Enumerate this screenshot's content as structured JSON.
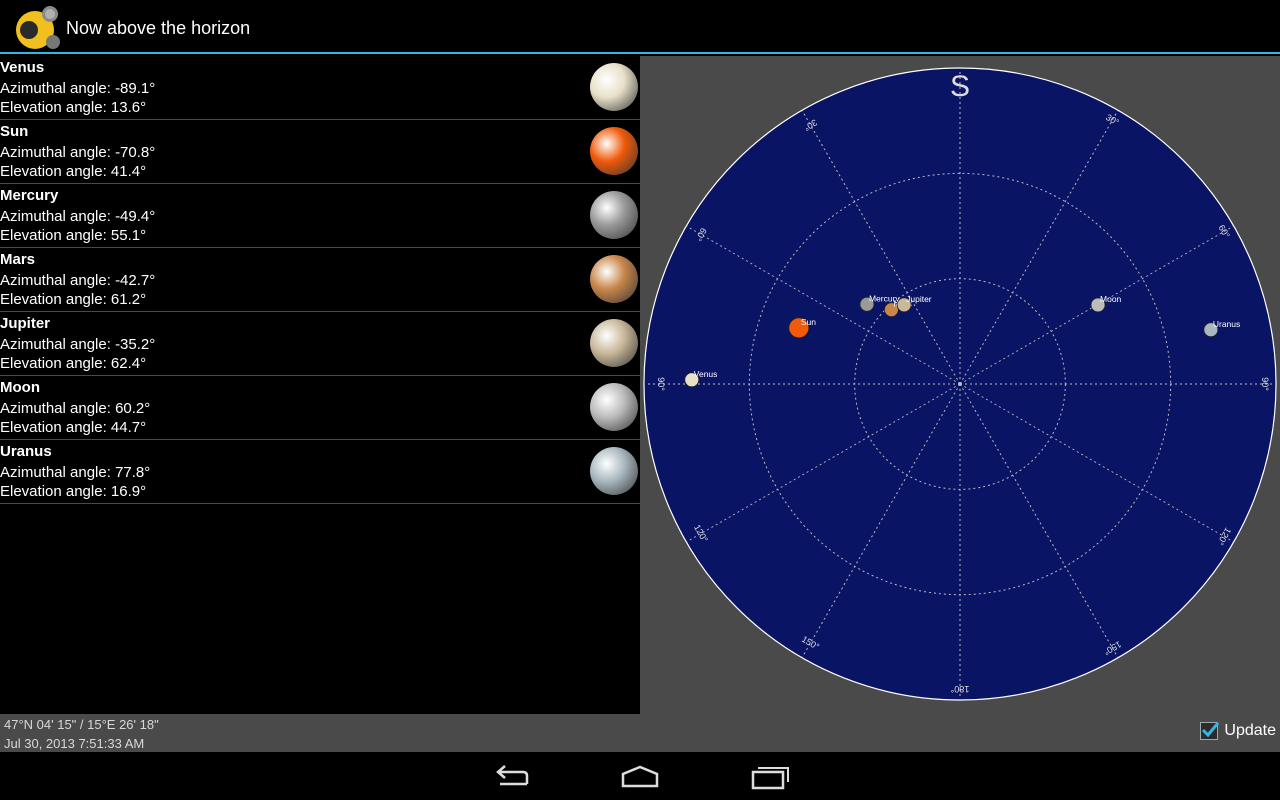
{
  "app": {
    "title": "Now above the horizon",
    "icon": "sun-planet-app-icon"
  },
  "bodies": [
    {
      "name": "Venus",
      "azimuth": "Azimuthal angle: -89.1°",
      "elevation": "Elevation angle: 13.6°",
      "az": -89.1,
      "el": 13.6,
      "color": "#e8e0c8"
    },
    {
      "name": "Sun",
      "azimuth": "Azimuthal angle: -70.8°",
      "elevation": "Elevation angle: 41.4°",
      "az": -70.8,
      "el": 41.4,
      "color": "#f05a0a"
    },
    {
      "name": "Mercury",
      "azimuth": "Azimuthal angle: -49.4°",
      "elevation": "Elevation angle: 55.1°",
      "az": -49.4,
      "el": 55.1,
      "color": "#9a9a9a"
    },
    {
      "name": "Mars",
      "azimuth": "Azimuthal angle: -42.7°",
      "elevation": "Elevation angle: 61.2°",
      "az": -42.7,
      "el": 61.2,
      "color": "#c8864a"
    },
    {
      "name": "Jupiter",
      "azimuth": "Azimuthal angle: -35.2°",
      "elevation": "Elevation angle: 62.4°",
      "az": -35.2,
      "el": 62.4,
      "color": "#c9b89a"
    },
    {
      "name": "Moon",
      "azimuth": "Azimuthal angle: 60.2°",
      "elevation": "Elevation angle: 44.7°",
      "az": 60.2,
      "el": 44.7,
      "color": "#bcbcbc"
    },
    {
      "name": "Uranus",
      "azimuth": "Azimuthal angle: 77.8°",
      "elevation": "Elevation angle: 16.9°",
      "az": 77.8,
      "el": 16.9,
      "color": "#a9b8c0"
    }
  ],
  "sky_chart": {
    "direction_label": "S",
    "azimuth_labels": [
      "30°",
      "60°",
      "90°",
      "120°",
      "150°",
      "180°",
      "150°",
      "120°",
      "90°",
      "60°",
      "30°"
    ],
    "background": "#0a1464",
    "panel_color": "#4a4a4a"
  },
  "footer": {
    "coords": "47°N 04' 15\" / 15°E 26' 18\"",
    "datetime": "Jul 30, 2013 7:51:33 AM",
    "update_label": "Update",
    "update_checked": true,
    "accent": "#33b5e5"
  },
  "navbar": {
    "back": "back-icon",
    "home": "home-icon",
    "recents": "recent-apps-icon"
  }
}
